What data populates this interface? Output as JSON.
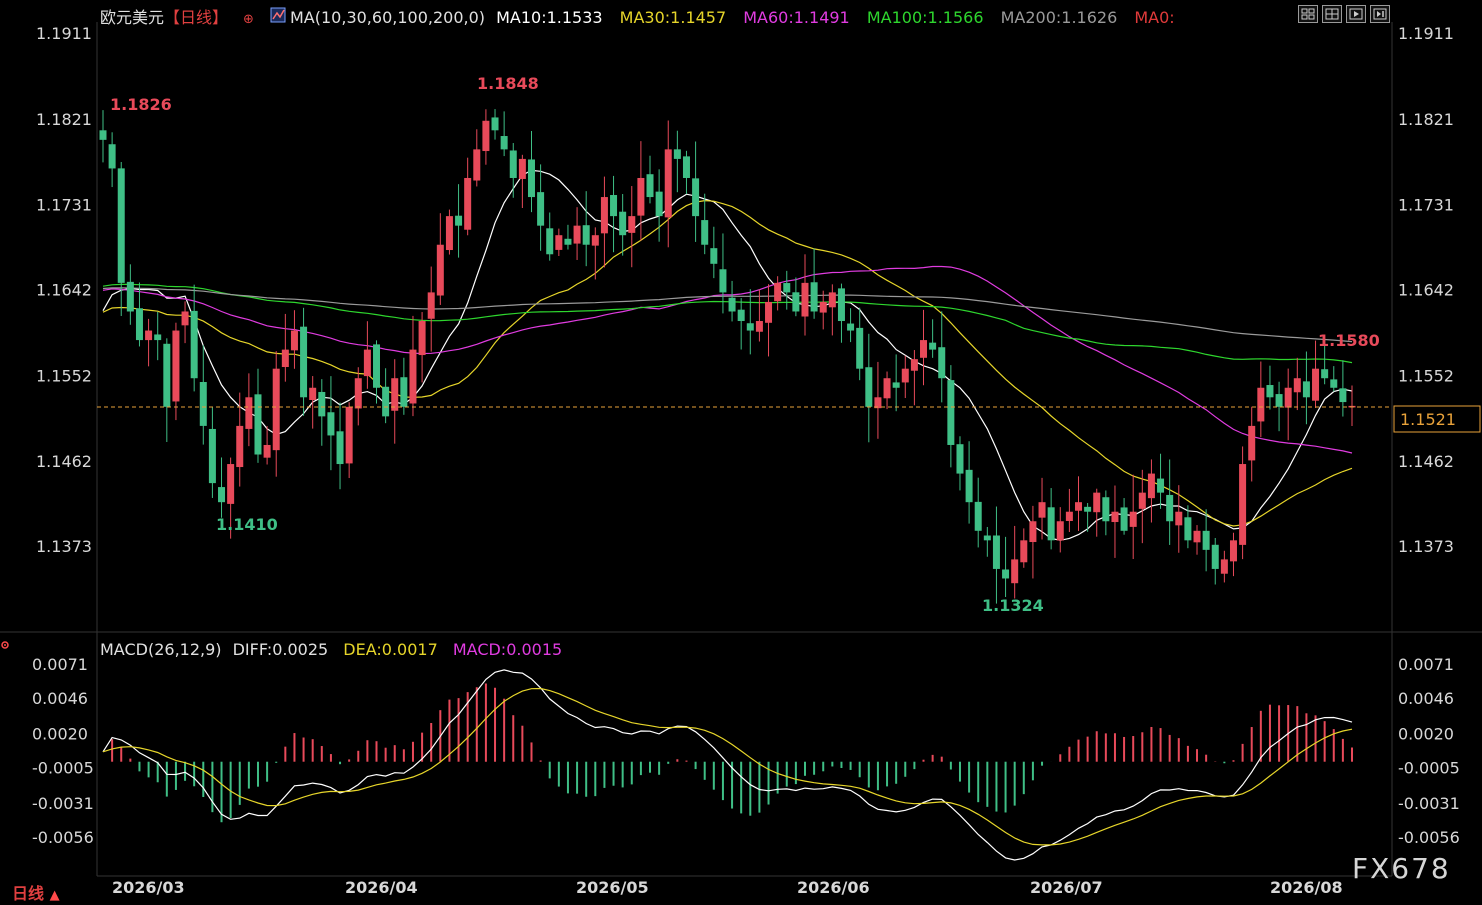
{
  "header": {
    "symbol": "欧元美元",
    "period": "【日线】",
    "ma_params": "MA(10,30,60,100,200,0)",
    "ma_values": [
      {
        "label": "MA10:1.1533",
        "color": "#ffffff"
      },
      {
        "label": "MA30:1.1457",
        "color": "#e6d52a"
      },
      {
        "label": "MA60:1.1491",
        "color": "#e03ce0"
      },
      {
        "label": "MA100:1.1566",
        "color": "#2ed62e"
      },
      {
        "label": "MA200:1.1626",
        "color": "#9a9a9a"
      },
      {
        "label": "MA0:",
        "color": "#e03a3a"
      }
    ]
  },
  "macd_header": {
    "params": "MACD(26,12,9)",
    "diff": "DIFF:0.0025",
    "dea": "DEA:0.0017",
    "macd": "MACD:0.0015"
  },
  "toolbar_icons": [
    "grid-icon",
    "layout-icon",
    "play-icon",
    "forward-icon"
  ],
  "period_tab": {
    "label": "日线",
    "arrow": "▲"
  },
  "watermark": "FX678",
  "colors": {
    "up": "#e84a5a",
    "down": "#3fbf86",
    "current_price": "#e8a23a"
  },
  "chart_data": [
    {
      "type": "candlestick",
      "title": "欧元美元【日线】",
      "x_labels": [
        "2026/03",
        "2026/04",
        "2026/05",
        "2026/06",
        "2026/07",
        "2026/08"
      ],
      "ylim": [
        1.13,
        1.194
      ],
      "yticks": [
        "1.1911",
        "1.1821",
        "1.1731",
        "1.1642",
        "1.1552",
        "1.1462",
        "1.1373"
      ],
      "current_price": "1.1521",
      "annotations": {
        "high_1": "1.1826",
        "high_2": "1.1848",
        "low_1": "1.1410",
        "low_2": "1.1324",
        "high_3": "1.1580"
      },
      "close": [
        1.18,
        1.177,
        1.165,
        1.162,
        1.159,
        1.16,
        1.159,
        1.152,
        1.16,
        1.162,
        1.155,
        1.15,
        1.144,
        1.142,
        1.146,
        1.15,
        1.153,
        1.147,
        1.148,
        1.156,
        1.158,
        1.16,
        1.153,
        1.154,
        1.151,
        1.149,
        1.146,
        1.152,
        1.155,
        1.158,
        1.154,
        1.151,
        1.155,
        1.152,
        1.158,
        1.161,
        1.164,
        1.169,
        1.172,
        1.171,
        1.176,
        1.179,
        1.182,
        1.181,
        1.179,
        1.176,
        1.178,
        1.174,
        1.171,
        1.168,
        1.17,
        1.169,
        1.171,
        1.169,
        1.17,
        1.174,
        1.172,
        1.17,
        1.172,
        1.176,
        1.174,
        1.172,
        1.179,
        1.178,
        1.176,
        1.172,
        1.169,
        1.167,
        1.164,
        1.162,
        1.161,
        1.16,
        1.161,
        1.163,
        1.165,
        1.164,
        1.162,
        1.165,
        1.162,
        1.163,
        1.164,
        1.161,
        1.16,
        1.156,
        1.152,
        1.153,
        1.155,
        1.154,
        1.156,
        1.157,
        1.159,
        1.158,
        1.155,
        1.148,
        1.145,
        1.142,
        1.139,
        1.138,
        1.135,
        1.134,
        1.136,
        1.138,
        1.14,
        1.142,
        1.138,
        1.14,
        1.141,
        1.142,
        1.141,
        1.143,
        1.14,
        1.141,
        1.139,
        1.141,
        1.143,
        1.145,
        1.143,
        1.14,
        1.141,
        1.138,
        1.139,
        1.137,
        1.135,
        1.136,
        1.138,
        1.146,
        1.15,
        1.154,
        1.153,
        1.152,
        1.154,
        1.155,
        1.153,
        1.156,
        1.155,
        1.154,
        1.1525,
        1.1521
      ],
      "ma": [
        {
          "name": "MA10",
          "value": "1.1533"
        },
        {
          "name": "MA30",
          "value": "1.1457"
        },
        {
          "name": "MA60",
          "value": "1.1491"
        },
        {
          "name": "MA100",
          "value": "1.1566"
        },
        {
          "name": "MA200",
          "value": "1.1626"
        }
      ]
    },
    {
      "type": "bar",
      "title": "MACD(26,12,9)",
      "x_labels": [
        "2026/03",
        "2026/04",
        "2026/05",
        "2026/06",
        "2026/07",
        "2026/08"
      ],
      "ylim": [
        -0.008,
        0.008
      ],
      "yticks": [
        "0.0071",
        "0.0046",
        "0.0020",
        "-0.0005",
        "-0.0031",
        "-0.0056"
      ],
      "series": [
        {
          "name": "DIFF",
          "value": "0.0025"
        },
        {
          "name": "DEA",
          "value": "0.0017"
        },
        {
          "name": "MACD",
          "value": "0.0015"
        }
      ]
    }
  ]
}
